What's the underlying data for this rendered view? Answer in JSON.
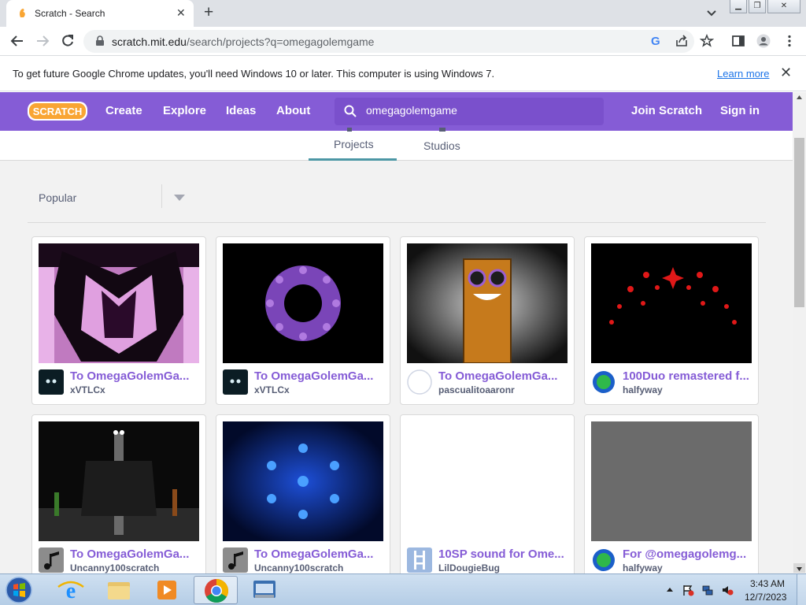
{
  "browser": {
    "tab_title": "Scratch - Search",
    "url_host": "scratch.mit.edu",
    "url_path": "/search/projects?q=omegagolemgame",
    "info_text": "To get future Google Chrome updates, you'll need Windows 10 or later. This computer is using Windows 7.",
    "info_link": "Learn more"
  },
  "scratch_nav": {
    "logo": "SCRATCH",
    "links": [
      "Create",
      "Explore",
      "Ideas",
      "About"
    ],
    "search_value": "omegagolemgame",
    "join": "Join Scratch",
    "signin": "Sign in",
    "brand_color": "#855cd6"
  },
  "results": {
    "tabs": [
      "Projects",
      "Studios"
    ],
    "active_tab": "Projects",
    "sort": "Popular",
    "projects": [
      {
        "title": "To OmegaGolemGa...",
        "author": "xVTLCx",
        "thumb": "pink-creature",
        "avatar": "dark-face"
      },
      {
        "title": "To OmegaGolemGa...",
        "author": "xVTLCx",
        "thumb": "purple-ring",
        "avatar": "dark-face"
      },
      {
        "title": "To OmegaGolemGa...",
        "author": "pascualitoaaronr",
        "thumb": "orange-block",
        "avatar": "blank-circle"
      },
      {
        "title": "100Duo remastered f...",
        "author": "halfyway",
        "thumb": "red-dots",
        "avatar": "green-globe"
      },
      {
        "title": "To OmegaGolemGa...",
        "author": "Uncanny100scratch",
        "thumb": "dark-tower",
        "avatar": "music-note"
      },
      {
        "title": "To OmegaGolemGa...",
        "author": "Uncanny100scratch",
        "thumb": "blue-ring",
        "avatar": "music-note"
      },
      {
        "title": "10SP sound for Ome...",
        "author": "LilDougieBug",
        "thumb": "blank",
        "avatar": "ladder-block"
      },
      {
        "title": "For @omegagolemg...",
        "author": "halfyway",
        "thumb": "grey",
        "avatar": "green-globe"
      }
    ]
  },
  "taskbar": {
    "time": "3:43 AM",
    "date": "12/7/2023",
    "apps": [
      "internet-explorer",
      "file-explorer",
      "media-player",
      "chrome",
      "keyboard"
    ]
  }
}
